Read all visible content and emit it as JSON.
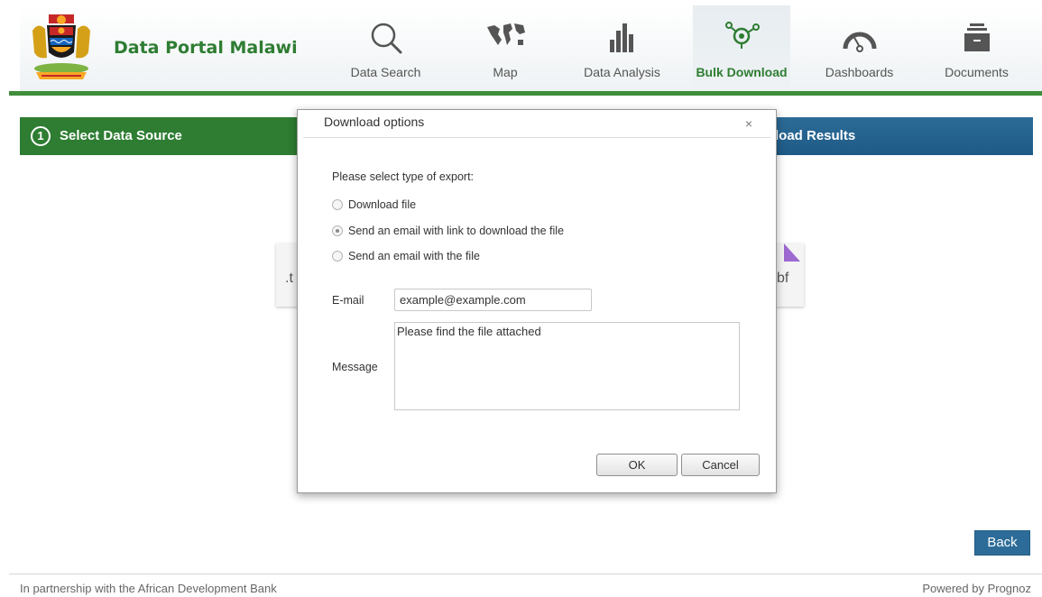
{
  "header": {
    "portal_title": "Data Portal Malawi",
    "nav": [
      {
        "label": "Data Search",
        "icon": "search-icon"
      },
      {
        "label": "Map",
        "icon": "world-map-icon"
      },
      {
        "label": "Data Analysis",
        "icon": "bar-chart-icon"
      },
      {
        "label": "Bulk Download",
        "icon": "bulk-download-icon",
        "active": true
      },
      {
        "label": "Dashboards",
        "icon": "gauge-icon"
      },
      {
        "label": "Documents",
        "icon": "file-cabinet-icon"
      }
    ],
    "accent_color": "#2e7d32"
  },
  "wizard": {
    "step1_number": "1",
    "step1_label": "Select Data Source",
    "step_last_label": "load Results"
  },
  "background_cards": {
    "left_text": ".t",
    "right_text": "bf"
  },
  "dialog": {
    "title": "Download options",
    "close_symbol": "×",
    "prompt": "Please select type of export:",
    "options": [
      {
        "label": "Download file",
        "checked": false
      },
      {
        "label": "Send an email with link to download the file",
        "checked": true
      },
      {
        "label": "Send an email with the file",
        "checked": false
      }
    ],
    "email_label": "E-mail",
    "email_value": "example@example.com",
    "message_label": "Message",
    "message_value": "Please find the file attached",
    "ok_label": "OK",
    "cancel_label": "Cancel"
  },
  "back_label": "Back",
  "footer": {
    "left": "In partnership with the African Development Bank",
    "right": "Powered by Prognoz"
  }
}
